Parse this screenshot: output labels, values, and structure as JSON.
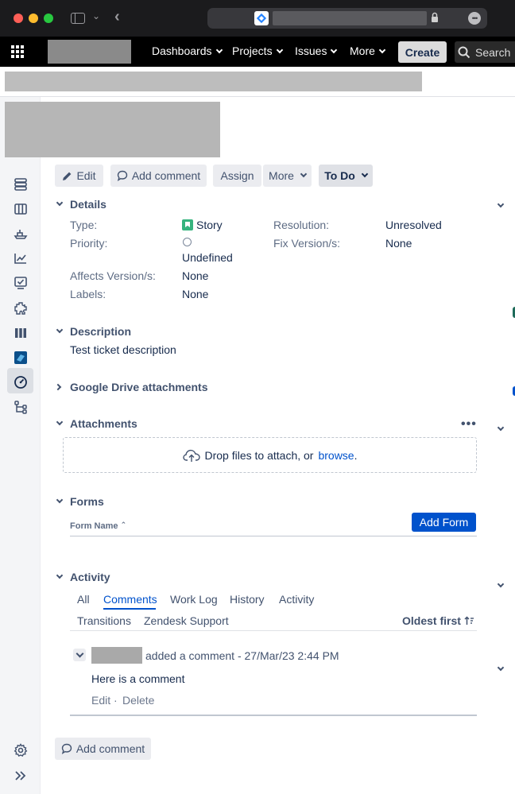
{
  "browser": {
    "controls": [
      "close",
      "minimize",
      "zoom"
    ],
    "icons": [
      "sidebar-toggle-icon",
      "chevron-down-icon",
      "back-arrow-icon",
      "lock-icon",
      "more-icon"
    ]
  },
  "topnav": {
    "items": [
      {
        "label": "Dashboards"
      },
      {
        "label": "Projects"
      },
      {
        "label": "Issues"
      },
      {
        "label": "More"
      }
    ],
    "create_label": "Create",
    "search_label": "Search"
  },
  "toolbar": {
    "edit_label": "Edit",
    "add_comment_label": "Add comment",
    "assign_label": "Assign",
    "more_label": "More",
    "status_label": "To Do"
  },
  "details": {
    "heading": "Details",
    "type_label": "Type:",
    "type_value": "Story",
    "priority_label": "Priority:",
    "priority_value": "Undefined",
    "affects_label": "Affects Version/s:",
    "affects_value": "None",
    "labels_label": "Labels:",
    "labels_value": "None",
    "resolution_label": "Resolution:",
    "resolution_value": "Unresolved",
    "fix_label": "Fix Version/s:",
    "fix_value": "None"
  },
  "description": {
    "heading": "Description",
    "text": "Test ticket description"
  },
  "gdrive": {
    "heading": "Google Drive attachments"
  },
  "attachments": {
    "heading": "Attachments",
    "drop_text": "Drop files to attach, or",
    "browse_link": "browse",
    "period": "."
  },
  "forms": {
    "heading": "Forms",
    "column_header": "Form Name",
    "sort_glyph": "⌃",
    "add_form_label": "Add Form"
  },
  "activity": {
    "heading": "Activity",
    "tabs": [
      {
        "label": "All"
      },
      {
        "label": "Comments"
      },
      {
        "label": "Work Log"
      },
      {
        "label": "History"
      },
      {
        "label": "Activity"
      },
      {
        "label": "Transitions"
      },
      {
        "label": "Zendesk Support"
      }
    ],
    "active_tab": "Comments",
    "sort_label": "Oldest first",
    "comment": {
      "meta": "added a comment - 27/Mar/23 2:44 PM",
      "body": "Here is a comment",
      "edit_label": "Edit",
      "separator": "·",
      "delete_label": "Delete"
    }
  },
  "footer": {
    "add_comment_label": "Add comment"
  },
  "sidebar": {
    "icons": [
      "backlog-icon",
      "board-icon",
      "releases-icon",
      "reports-icon",
      "issues-icon",
      "add-ons-icon",
      "components-icon",
      "app-icon",
      "dashboard-gauge-icon",
      "hierarchy-icon",
      "settings-icon",
      "expand-icon"
    ]
  },
  "colors": {
    "accent": "#0052cc",
    "story": "#36b37e",
    "nav_bg": "#000000",
    "sidebar_bg": "#f4f5f7"
  }
}
